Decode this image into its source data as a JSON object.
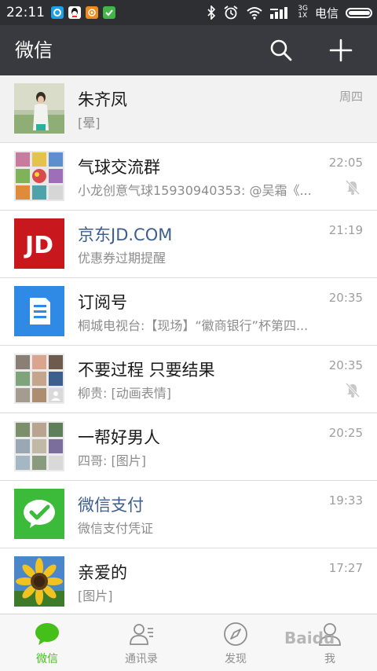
{
  "status_bar": {
    "time": "22:11",
    "network_label": "3G",
    "network_sub": "1X",
    "carrier": "电信"
  },
  "app_bar": {
    "title": "微信",
    "search_icon": "search-icon",
    "add_icon": "plus-icon"
  },
  "chats": [
    {
      "name": "朱齐凤",
      "preview": "[晕]",
      "time": "周四",
      "muted": false,
      "pinned": true,
      "official": false
    },
    {
      "name": "气球交流群",
      "preview": "小龙创意气球15930940353: @吴霜《...",
      "time": "22:05",
      "muted": true,
      "pinned": false,
      "official": false
    },
    {
      "name": "京东JD.COM",
      "preview": "优惠券过期提醒",
      "time": "21:19",
      "muted": false,
      "pinned": false,
      "official": true
    },
    {
      "name": "订阅号",
      "preview": "桐城电视台:【现场】“徽商银行”杯第四...",
      "time": "20:35",
      "muted": false,
      "pinned": false,
      "official": false
    },
    {
      "name": "不要过程 只要结果",
      "preview": "柳贵: [动画表情]",
      "time": "20:35",
      "muted": true,
      "pinned": false,
      "official": false
    },
    {
      "name": "一帮好男人",
      "preview": "四哥: [图片]",
      "time": "20:25",
      "muted": false,
      "pinned": false,
      "official": false
    },
    {
      "name": "微信支付",
      "preview": "微信支付凭证",
      "time": "19:33",
      "muted": false,
      "pinned": false,
      "official": true
    },
    {
      "name": "亲爱的",
      "preview": "[图片]",
      "time": "17:27",
      "muted": false,
      "pinned": false,
      "official": false
    }
  ],
  "avatars": {
    "jd_text": "JD"
  },
  "tabs": [
    {
      "label": "微信",
      "icon": "chat-bubble-icon",
      "active": true
    },
    {
      "label": "通讯录",
      "icon": "contacts-icon",
      "active": false
    },
    {
      "label": "发现",
      "icon": "compass-icon",
      "active": false
    },
    {
      "label": "我",
      "icon": "person-icon",
      "active": false
    }
  ],
  "watermark": "Baidu",
  "colors": {
    "accent": "#45c01a",
    "app_bar": "#393a3f",
    "status_bar": "#2e2f33",
    "official_name": "#3d5e8e",
    "jd_red": "#c9171e",
    "subscription_blue": "#2f8ae6",
    "wepay_green": "#3cbb3a"
  }
}
